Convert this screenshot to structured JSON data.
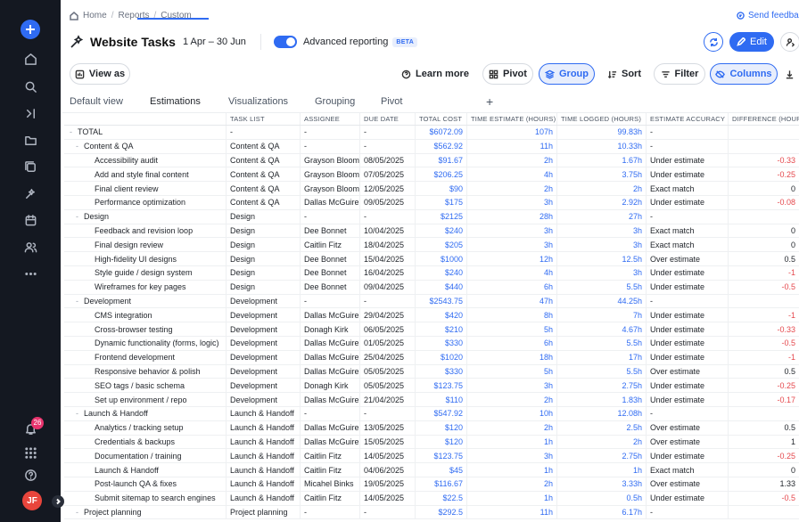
{
  "breadcrumb": {
    "home": "Home",
    "reports": "Reports",
    "custom": "Custom"
  },
  "feedback_label": "Send feedback",
  "header": {
    "title": "Website Tasks",
    "date_range": "1 Apr – 30 Jun",
    "advanced_label": "Advanced reporting",
    "beta_label": "BETA",
    "edit_label": "Edit"
  },
  "toolbar": {
    "view_as": "View as",
    "learn_more": "Learn more",
    "pivot": "Pivot",
    "group": "Group",
    "sort": "Sort",
    "filter": "Filter",
    "columns": "Columns"
  },
  "tabs": [
    "Default view",
    "Estimations",
    "Visualizations",
    "Grouping",
    "Pivot"
  ],
  "active_tab": "Estimations",
  "notifications_count": "26",
  "user_initials": "JF",
  "colors": {
    "accent": "#2f6bf2",
    "negative": "#e5484d",
    "sidebar": "#141821",
    "badge": "#e8336d"
  },
  "columns": [
    "",
    "TASK LIST",
    "ASSIGNEE",
    "DUE DATE",
    "TOTAL COST",
    "TIME ESTIMATE (HOURS)",
    "TIME LOGGED (HOURS)",
    "ESTIMATE ACCURACY",
    "DIFFERENCE (HOURS)"
  ],
  "rows": [
    {
      "level": 0,
      "toggle": "-",
      "name": "TOTAL",
      "list": "-",
      "assignee": "-",
      "due": "-",
      "cost": "$6072.09",
      "est": "107h",
      "logged": "99.83h",
      "accuracy": "-",
      "diff": ""
    },
    {
      "level": 1,
      "toggle": "-",
      "name": "Content & QA",
      "list": "Content & QA",
      "assignee": "-",
      "due": "-",
      "cost": "$562.92",
      "est": "11h",
      "logged": "10.33h",
      "accuracy": "-",
      "diff": ""
    },
    {
      "level": 2,
      "name": "Accessibility audit",
      "list": "Content & QA",
      "assignee": "Grayson Bloom",
      "due": "08/05/2025",
      "cost": "$91.67",
      "est": "2h",
      "logged": "1.67h",
      "accuracy": "Under estimate",
      "diff": "-0.33",
      "neg": true
    },
    {
      "level": 2,
      "name": "Add and style final content",
      "list": "Content & QA",
      "assignee": "Grayson Bloom",
      "due": "07/05/2025",
      "cost": "$206.25",
      "est": "4h",
      "logged": "3.75h",
      "accuracy": "Under estimate",
      "diff": "-0.25",
      "neg": true
    },
    {
      "level": 2,
      "name": "Final client review",
      "list": "Content & QA",
      "assignee": "Grayson Bloom",
      "due": "12/05/2025",
      "cost": "$90",
      "est": "2h",
      "logged": "2h",
      "accuracy": "Exact match",
      "diff": "0"
    },
    {
      "level": 2,
      "name": "Performance optimization",
      "list": "Content & QA",
      "assignee": "Dallas McGuire",
      "due": "09/05/2025",
      "cost": "$175",
      "est": "3h",
      "logged": "2.92h",
      "accuracy": "Under estimate",
      "diff": "-0.08",
      "neg": true
    },
    {
      "level": 1,
      "toggle": "-",
      "name": "Design",
      "list": "Design",
      "assignee": "-",
      "due": "-",
      "cost": "$2125",
      "est": "28h",
      "logged": "27h",
      "accuracy": "-",
      "diff": ""
    },
    {
      "level": 2,
      "name": "Feedback and revision loop",
      "list": "Design",
      "assignee": "Dee Bonnet",
      "due": "10/04/2025",
      "cost": "$240",
      "est": "3h",
      "logged": "3h",
      "accuracy": "Exact match",
      "diff": "0"
    },
    {
      "level": 2,
      "name": "Final design review",
      "list": "Design",
      "assignee": "Caitlin Fitz",
      "due": "18/04/2025",
      "cost": "$205",
      "est": "3h",
      "logged": "3h",
      "accuracy": "Exact match",
      "diff": "0"
    },
    {
      "level": 2,
      "name": "High-fidelity UI designs",
      "list": "Design",
      "assignee": "Dee Bonnet",
      "due": "15/04/2025",
      "cost": "$1000",
      "est": "12h",
      "logged": "12.5h",
      "accuracy": "Over estimate",
      "diff": "0.5"
    },
    {
      "level": 2,
      "name": "Style guide / design system",
      "list": "Design",
      "assignee": "Dee Bonnet",
      "due": "16/04/2025",
      "cost": "$240",
      "est": "4h",
      "logged": "3h",
      "accuracy": "Under estimate",
      "diff": "-1",
      "neg": true
    },
    {
      "level": 2,
      "name": "Wireframes for key pages",
      "list": "Design",
      "assignee": "Dee Bonnet",
      "due": "09/04/2025",
      "cost": "$440",
      "est": "6h",
      "logged": "5.5h",
      "accuracy": "Under estimate",
      "diff": "-0.5",
      "neg": true
    },
    {
      "level": 1,
      "toggle": "-",
      "name": "Development",
      "list": "Development",
      "assignee": "-",
      "due": "-",
      "cost": "$2543.75",
      "est": "47h",
      "logged": "44.25h",
      "accuracy": "-",
      "diff": ""
    },
    {
      "level": 2,
      "name": "CMS integration",
      "list": "Development",
      "assignee": "Dallas McGuire",
      "due": "29/04/2025",
      "cost": "$420",
      "est": "8h",
      "logged": "7h",
      "accuracy": "Under estimate",
      "diff": "-1",
      "neg": true
    },
    {
      "level": 2,
      "name": "Cross-browser testing",
      "list": "Development",
      "assignee": "Donagh Kirk",
      "due": "06/05/2025",
      "cost": "$210",
      "est": "5h",
      "logged": "4.67h",
      "accuracy": "Under estimate",
      "diff": "-0.33",
      "neg": true
    },
    {
      "level": 2,
      "name": "Dynamic functionality (forms, logic)",
      "list": "Development",
      "assignee": "Dallas McGuire",
      "due": "01/05/2025",
      "cost": "$330",
      "est": "6h",
      "logged": "5.5h",
      "accuracy": "Under estimate",
      "diff": "-0.5",
      "neg": true
    },
    {
      "level": 2,
      "name": "Frontend development",
      "list": "Development",
      "assignee": "Dallas McGuire",
      "due": "25/04/2025",
      "cost": "$1020",
      "est": "18h",
      "logged": "17h",
      "accuracy": "Under estimate",
      "diff": "-1",
      "neg": true
    },
    {
      "level": 2,
      "name": "Responsive behavior & polish",
      "list": "Development",
      "assignee": "Dallas McGuire",
      "due": "05/05/2025",
      "cost": "$330",
      "est": "5h",
      "logged": "5.5h",
      "accuracy": "Over estimate",
      "diff": "0.5"
    },
    {
      "level": 2,
      "name": "SEO tags / basic schema",
      "list": "Development",
      "assignee": "Donagh Kirk",
      "due": "05/05/2025",
      "cost": "$123.75",
      "est": "3h",
      "logged": "2.75h",
      "accuracy": "Under estimate",
      "diff": "-0.25",
      "neg": true
    },
    {
      "level": 2,
      "name": "Set up environment / repo",
      "list": "Development",
      "assignee": "Dallas McGuire",
      "due": "21/04/2025",
      "cost": "$110",
      "est": "2h",
      "logged": "1.83h",
      "accuracy": "Under estimate",
      "diff": "-0.17",
      "neg": true
    },
    {
      "level": 1,
      "toggle": "-",
      "name": "Launch & Handoff",
      "list": "Launch & Handoff",
      "assignee": "-",
      "due": "-",
      "cost": "$547.92",
      "est": "10h",
      "logged": "12.08h",
      "accuracy": "-",
      "diff": ""
    },
    {
      "level": 2,
      "name": "Analytics / tracking setup",
      "list": "Launch & Handoff",
      "assignee": "Dallas McGuire",
      "due": "13/05/2025",
      "cost": "$120",
      "est": "2h",
      "logged": "2.5h",
      "accuracy": "Over estimate",
      "diff": "0.5"
    },
    {
      "level": 2,
      "name": "Credentials & backups",
      "list": "Launch & Handoff",
      "assignee": "Dallas McGuire",
      "due": "15/05/2025",
      "cost": "$120",
      "est": "1h",
      "logged": "2h",
      "accuracy": "Over estimate",
      "diff": "1"
    },
    {
      "level": 2,
      "name": "Documentation / training",
      "list": "Launch & Handoff",
      "assignee": "Caitlin Fitz",
      "due": "14/05/2025",
      "cost": "$123.75",
      "est": "3h",
      "logged": "2.75h",
      "accuracy": "Under estimate",
      "diff": "-0.25",
      "neg": true
    },
    {
      "level": 2,
      "name": "Launch & Handoff",
      "list": "Launch & Handoff",
      "assignee": "Caitlin Fitz",
      "due": "04/06/2025",
      "cost": "$45",
      "est": "1h",
      "logged": "1h",
      "accuracy": "Exact match",
      "diff": "0"
    },
    {
      "level": 2,
      "name": "Post-launch QA & fixes",
      "list": "Launch & Handoff",
      "assignee": "Micahel Binks",
      "due": "19/05/2025",
      "cost": "$116.67",
      "est": "2h",
      "logged": "3.33h",
      "accuracy": "Over estimate",
      "diff": "1.33"
    },
    {
      "level": 2,
      "name": "Submit sitemap to search engines",
      "list": "Launch & Handoff",
      "assignee": "Caitlin Fitz",
      "due": "14/05/2025",
      "cost": "$22.5",
      "est": "1h",
      "logged": "0.5h",
      "accuracy": "Under estimate",
      "diff": "-0.5",
      "neg": true
    },
    {
      "level": 1,
      "toggle": "-",
      "name": "Project planning",
      "list": "Project planning",
      "assignee": "-",
      "due": "-",
      "cost": "$292.5",
      "est": "11h",
      "logged": "6.17h",
      "accuracy": "-",
      "diff": ""
    }
  ]
}
